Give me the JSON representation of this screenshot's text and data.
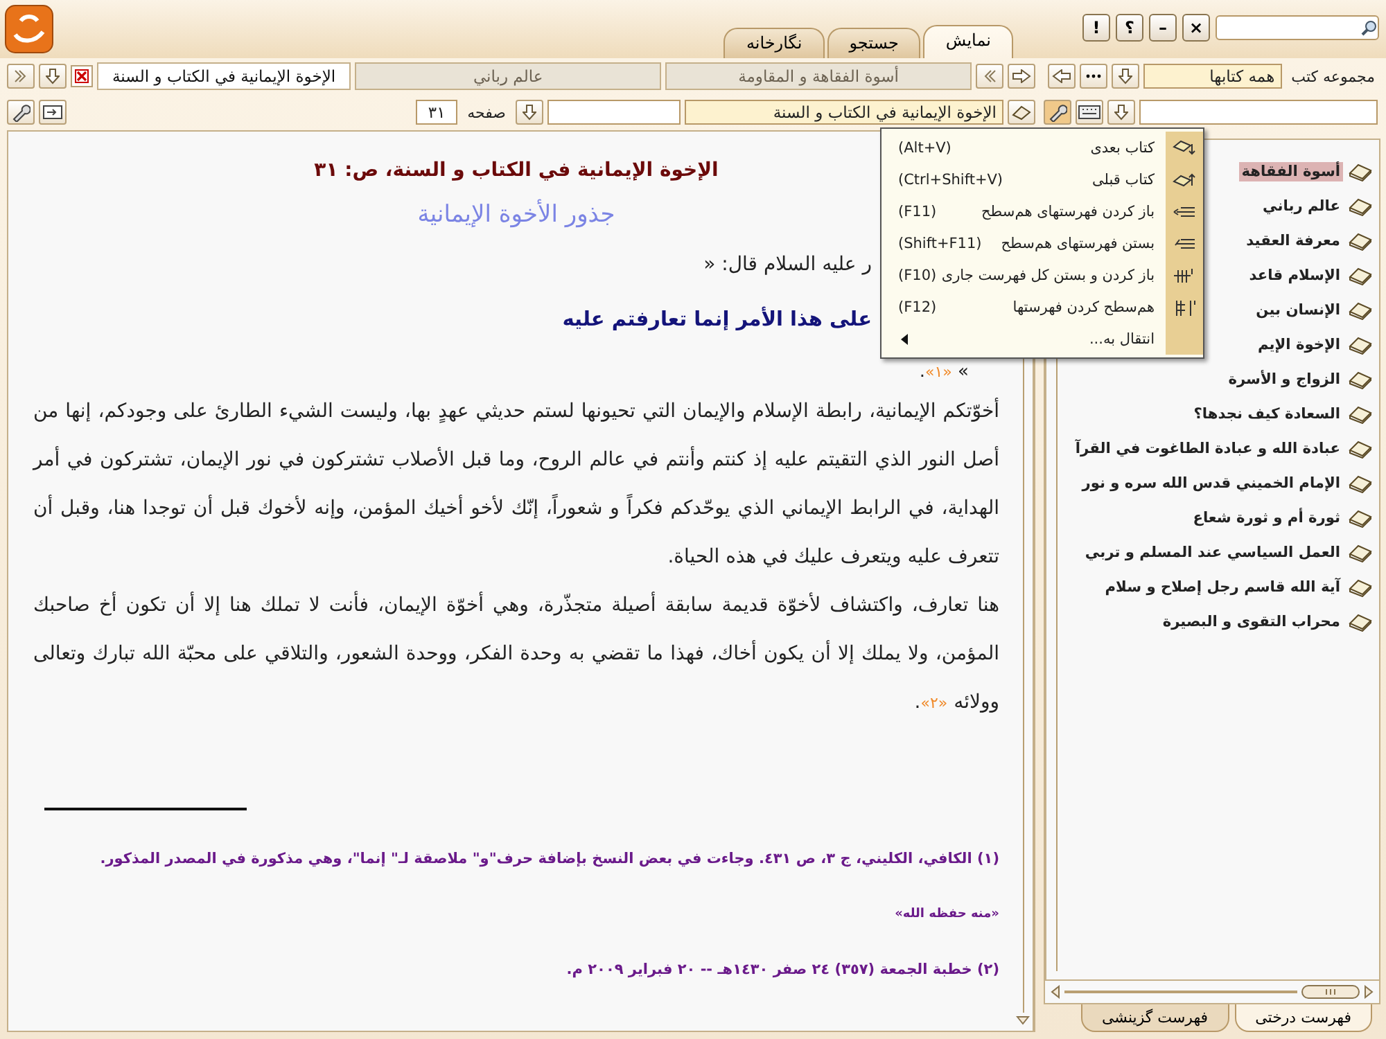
{
  "window_buttons": [
    "×",
    "–",
    "؟",
    "!"
  ],
  "tabs": [
    {
      "label": "نمایش",
      "selected": true
    },
    {
      "label": "جستجو",
      "selected": false
    },
    {
      "label": "نگارخانه",
      "selected": false
    }
  ],
  "sidebar": {
    "collection_label": "مجموعه کتب",
    "collection_value": "همه کتابها",
    "books": [
      {
        "title": "أسوة الفقاهة",
        "selected": true
      },
      {
        "title": "عالم رباني",
        "selected": false
      },
      {
        "title": "معرفة العقيد",
        "selected": false
      },
      {
        "title": "الإسلام قاعد",
        "selected": false
      },
      {
        "title": "الإنسان بين",
        "selected": false
      },
      {
        "title": "الإخوة الإيم",
        "selected": false
      },
      {
        "title": "الزواج و الأسرة",
        "selected": false
      },
      {
        "title": "السعادة كيف نجدها؟",
        "selected": false
      },
      {
        "title": "عبادة الله و عبادة الطاغوت في القرآ",
        "selected": false
      },
      {
        "title": "الإمام الخميني قدس الله سره و نور",
        "selected": false
      },
      {
        "title": "ثورة أم و ثورة شعاع",
        "selected": false
      },
      {
        "title": "العمل السياسي عند المسلم و تربي",
        "selected": false
      },
      {
        "title": "آية الله قاسم رجل إصلاح و سلام",
        "selected": false
      },
      {
        "title": "محراب التقوى و البصيرة",
        "selected": false
      }
    ],
    "bottom_tabs": [
      {
        "label": "فهرست درختی",
        "selected": true
      },
      {
        "label": "فهرست گزینشی",
        "selected": false
      }
    ]
  },
  "document_tabs": [
    {
      "label": "أسوة الفقاهة و المقاومة",
      "selected": false
    },
    {
      "label": "عالم رباني",
      "selected": false
    },
    {
      "label": "الإخوة الإيمانية في الكتاب و السنة",
      "selected": true
    }
  ],
  "nav": {
    "book_field": "الإخوة الإيمانية في الكتاب و السنة",
    "page_label": "صفحه",
    "page_value": "۳۱"
  },
  "content": {
    "heading": "الإخوة الإيمانية في الكتاب و السنة، ص: ۳۱",
    "subtitle": "جذور الأخوة الإيمانية",
    "lines": [
      {
        "kind": "intro",
        "text": "ر عليه السلام قال: «"
      },
      {
        "kind": "hadith",
        "text": "على هذا الأمر إنما تعارفتم عليه"
      },
      {
        "kind": "close",
        "text": "» ",
        "note": "«١»",
        "end": "."
      }
    ],
    "paragraphs": [
      {
        "text": "أخوّتكم الإيمانية، رابطة الإسلام والإيمان التي تحيونها لستم حديثي عهدٍ بها، وليست الشيء الطارئ على وجودكم، إنها من أصل النور الذي التقيتم عليه إذ كنتم وأنتم في عالم الروح، وما قبل الأصلاب تشتركون في نور الإيمان، تشتركون في أمر الهداية، في الرابط الإيماني الذي يوحّدكم فكراً و شعوراً، إنّك لأخو أخيك المؤمن، وإنه لأخوك قبل أن توجدا هنا، وقبل أن تتعرف عليه ويتعرف عليك في هذه الحياة."
      },
      {
        "text": "هنا تعارف، واكتشاف لأخوّة قديمة سابقة أصيلة متجذّرة، وهي أخوّة الإيمان، فأنت لا تملك هنا إلا أن تكون أخ صاحبك المؤمن، ولا يملك إلا أن يكون أخاك، فهذا ما تقضي به وحدة الفكر، ووحدة الشعور، والتلاقي على محبّة الله تبارك وتعالى وولائه ",
        "note": "«٢»",
        "end": "."
      }
    ],
    "footnotes": [
      {
        "kind": "note",
        "text": "(١) الكافي، الكليني، ج ٣، ص ٤٣١. وجاءت في بعض النسخ بإضافة حرف\"و\" ملاصقة لـ\" إنما\"، وهي مذكورة في المصدر المذكور."
      },
      {
        "kind": "small",
        "text": "«منه حفظه الله»"
      },
      {
        "kind": "note",
        "text": "(٢) خطبة الجمعة (٣٥٧) ٢٤ صفر ١٤٣٠هـ -- ٢٠ فبراير ٢٠٠٩ م."
      }
    ]
  },
  "context_menu": {
    "items": [
      {
        "kind": "command",
        "label": "کتاب بعدی",
        "shortcut": "(Alt+V)"
      },
      {
        "kind": "command",
        "label": "کتاب قبلی",
        "shortcut": "(Ctrl+Shift+V)"
      },
      {
        "kind": "command",
        "label": "باز کردن فهرستهای هم‌سطح",
        "shortcut": "(F11)"
      },
      {
        "kind": "command",
        "label": "بستن فهرستهای هم‌سطح",
        "shortcut": "(Shift+F11)"
      },
      {
        "kind": "command",
        "label": "باز کردن و بستن کل فهرست جاری",
        "shortcut": "(F10)"
      },
      {
        "kind": "command",
        "label": "هم‌سطح کردن فهرستها",
        "shortcut": "(F12)"
      },
      {
        "kind": "submenu",
        "label": "انتقال به..."
      }
    ]
  }
}
